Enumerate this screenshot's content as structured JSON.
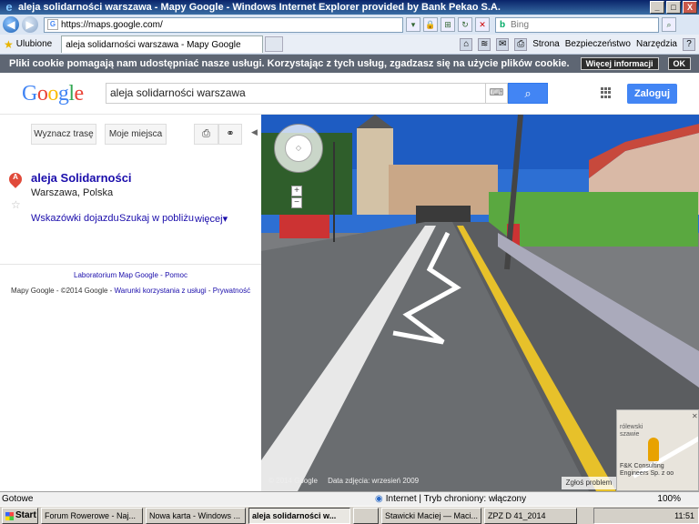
{
  "window": {
    "title": "aleja solidarności warszawa - Mapy Google - Windows Internet Explorer provided by Bank Pekao S.A.",
    "btn_min": "_",
    "btn_max": "□",
    "btn_close": "X"
  },
  "browser": {
    "url": "https://maps.google.com/",
    "search_placeholder": "Bing",
    "favorites_label": "Ulubione",
    "tab_title": "aleja solidarności warszawa - Mapy Google",
    "cmd_page": "Strona",
    "cmd_safety": "Bezpieczeństwo",
    "cmd_tools": "Narzędzia"
  },
  "cookie_bar": {
    "text": "Pliki cookie pomagają nam udostępniać nasze usługi. Korzystając z tych usług, zgadzasz się na użycie plików cookie.",
    "more_info": "Więcej informacji",
    "ok": "OK"
  },
  "google": {
    "logo": [
      "G",
      "o",
      "o",
      "g",
      "l",
      "e"
    ],
    "query": "aleja solidarności warszawa",
    "login": "Zaloguj"
  },
  "panel": {
    "route_btn": "Wyznacz trasę",
    "my_places": "Moje miejsca",
    "marker_letter": "A",
    "place_name": "aleja Solidarności",
    "place_address": "Warszawa, Polska",
    "action_directions": "Wskazówki dojazdu",
    "action_nearby": "Szukaj w pobliżu",
    "action_more": "więcej▾",
    "footer_links": "Laboratorium Map Google - Pomoc",
    "footer_brand": "Mapy Google",
    "footer_copyright": "- ©2014 Google -",
    "footer_terms": "Warunki korzystania z usługi",
    "footer_privacy": "Prywatność"
  },
  "streetview": {
    "copyright": "© 2014 Google",
    "image_date": "Data zdjęcia: wrzesień 2009",
    "report": "Zgłoś problem",
    "minimap_label_top": "rólewski\nszawie",
    "minimap_label_bottom": "F&K Consulting\nEngineers Sp. z oo"
  },
  "status_bar": {
    "left": "Gotowe",
    "zone": "Internet | Tryb chroniony: włączony",
    "zoom": "100%"
  },
  "taskbar": {
    "start": "Start",
    "items": [
      "Forum Rowerowe - Naj...",
      "Nowa karta - Windows ...",
      "aleja solidarności w...",
      "",
      "Stawicki Maciej — Maci...",
      "ZPZ D 41_2014"
    ],
    "clock": "11:51"
  }
}
